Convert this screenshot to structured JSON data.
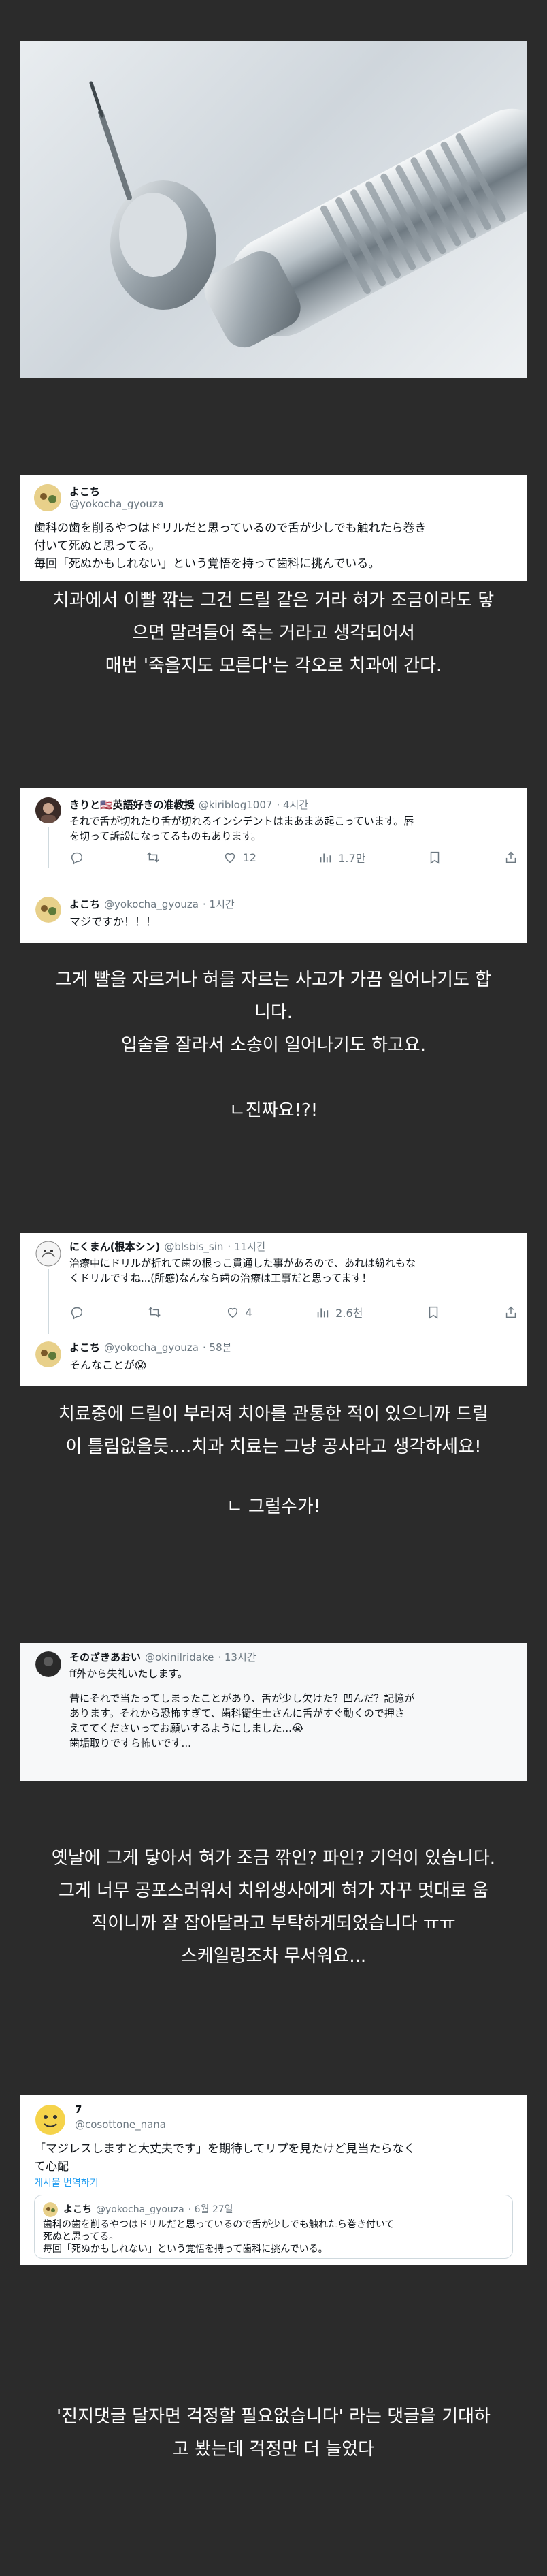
{
  "tweet1": {
    "name": "よこち",
    "handle": "@yokocha_gyouza",
    "lines": [
      "歯科の歯を削るやつはドリルだと思っているので舌が少しでも触れたら巻き",
      "付いて死ぬと思ってる。",
      "毎回「死ぬかもしれない」という覚悟を持って歯科に挑んでいる。"
    ]
  },
  "caption1": [
    "치과에서 이빨 깎는 그건 드릴 같은 거라 혀가 조금이라도 닿",
    "으면 말려들어 죽는 거라고 생각되어서",
    "매번 '죽을지도 모른다'는 각오로 치과에 간다."
  ],
  "tweet2": {
    "name": "きりと🇺🇸英語好きの准教授",
    "handle": "@kiriblog1007",
    "time": "· 4시간",
    "lines": [
      "それで舌が切れたり舌が切れるインシデントはまあまあ起こっています。唇",
      "を切って訴訟になってるものもあります。"
    ],
    "reply_count": "",
    "retweet_count": "",
    "like_count": "12",
    "view_count": "1.7만",
    "reply": {
      "name": "よこち",
      "handle": "@yokocha_gyouza",
      "time": "· 1시간",
      "text": "マジですか！！！"
    }
  },
  "caption2": [
    "그게 빨을 자르거나 혀를 자르는 사고가 가끔 일어나기도 합",
    "니다.",
    "입술을 잘라서 소송이 일어나기도 하고요.",
    "",
    "ㄴ진짜요!?!"
  ],
  "tweet3": {
    "name": "にくまん(根本シン)",
    "handle": "@blsbis_sin",
    "time": "· 11시간",
    "lines": [
      "治療中にドリルが折れて歯の根っこ貫通した事があるので、あれは紛れもな",
      "くドリルですね...(所感)なんなら歯の治療は工事だと思ってます！"
    ],
    "like_count": "4",
    "view_count": "2.6천",
    "reply": {
      "name": "よこち",
      "handle": "@yokocha_gyouza",
      "time": "· 58분",
      "text": "そんなことが😱"
    }
  },
  "caption3": [
    "치료중에 드릴이 부러져 치아를 관통한 적이 있으니까 드릴",
    "이 틀림없을듯....치과 치료는 그냥 공사라고 생각하세요!",
    "",
    "ㄴ 그럴수가!"
  ],
  "tweet4": {
    "name": "そのざきあおい",
    "handle": "@okinilridake",
    "time": "· 13시간",
    "lines": [
      "ff外から失礼いたします。",
      "",
      "昔にそれで当たってしまったことがあり、舌が少し欠けた？凹んだ？記憶が",
      "あります。それから恐怖すぎて、歯科衛生士さんに舌がすぐ動くので押さ",
      "えててくださいってお願いするようにしました...😭",
      "歯垢取りですら怖いです..."
    ]
  },
  "caption4": [
    "옛날에 그게 닿아서 혀가 조금 깎인? 파인? 기억이 있습니다.",
    "그게 너무 공포스러워서 치위생사에게 혀가 자꾸 멋대로 움",
    "직이니까 잘 잡아달라고 부탁하게되었습니다 ㅠㅠ",
    "스케일링조차 무서워요..."
  ],
  "tweet5": {
    "name": "7",
    "handle": "@cosottone_nana",
    "lines": [
      "「マジレスしますと大丈夫です」を期待してリプを見たけど見当たらなく",
      "て心配"
    ],
    "translate": "게시물 번역하기",
    "quote": {
      "name": "よこち",
      "handle": "@yokocha_gyouza",
      "time": "· 6월 27일",
      "lines": [
        "歯科の歯を削るやつはドリルだと思っているので舌が少しでも触れたら巻き付いて",
        "死ぬと思ってる。",
        "毎回「死ぬかもしれない」という覚悟を持って歯科に挑んでいる。"
      ]
    }
  },
  "caption5": [
    "'진지댓글 달자면 걱정할 필요없습니다' 라는 댓글을 기대하",
    "고 봤는데 걱정만 더 늘었다"
  ]
}
